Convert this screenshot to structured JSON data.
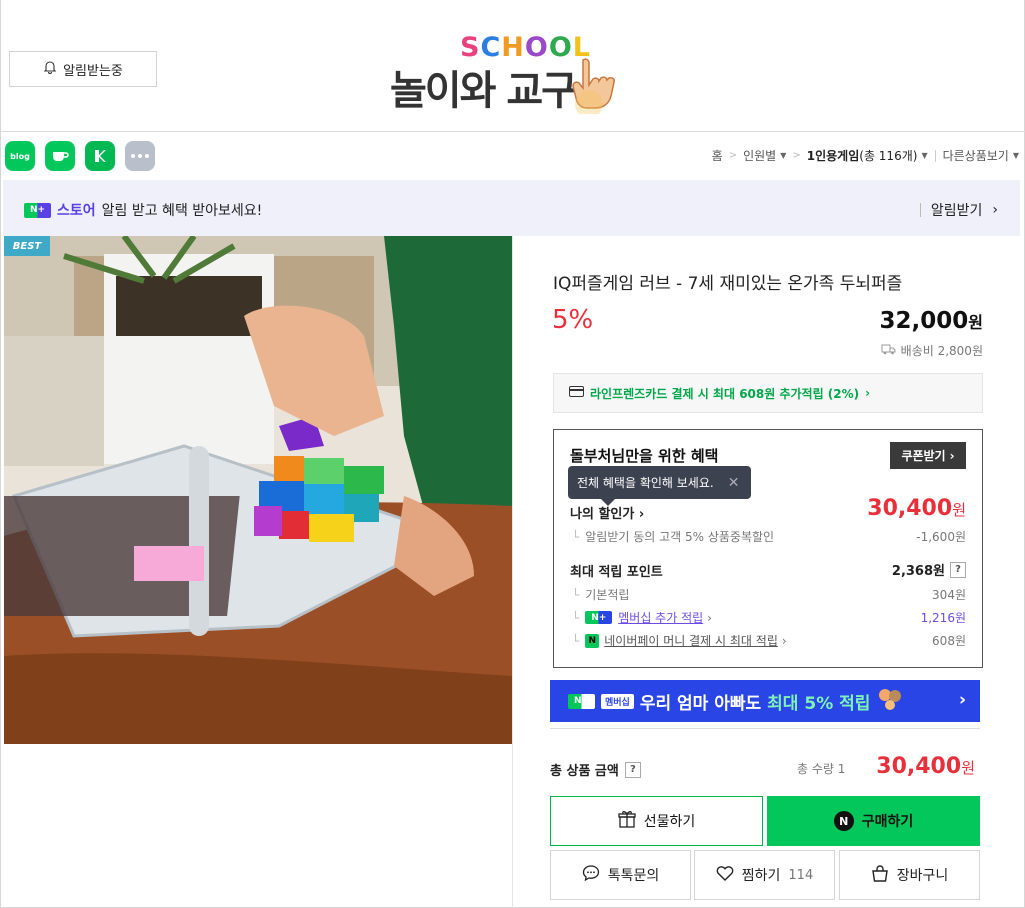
{
  "header": {
    "alarm_label": "알림받는중",
    "logo_main": "놀이와 교구",
    "logo_school": "SCHOOL"
  },
  "share": {
    "icons": [
      "blog-icon",
      "cafe-icon",
      "band-icon",
      "more-icon"
    ],
    "blog_text": "blog"
  },
  "breadcrumb": {
    "home": "홈",
    "level1": "인원별",
    "level2_prefix": "1인용게임",
    "level2_count": "(총 116개)",
    "other": "다른상품보기"
  },
  "notice": {
    "npbadge": "N+",
    "store": "스토어",
    "message": "알림 받고 혜택 받아보세요!",
    "action": "알림받기"
  },
  "product": {
    "badge": "BEST",
    "title": "IQ퍼즐게임 러브 - 7세 재미있는 온가족 두뇌퍼즐",
    "discount": "5%",
    "price": "32,000",
    "price_unit": "원",
    "shipping": "배송비 2,800원",
    "card_benefit": "라인프렌즈카드 결제 시 최대 608원 추가적립 (2%)"
  },
  "benefit": {
    "title": "돌부처님만을 위한 혜택",
    "coupon_btn": "쿠폰받기",
    "tooltip": "전체 혜택을 확인해 보세요.",
    "my_discount_label": "나의 할인가",
    "my_discount_price": "30,400",
    "my_discount_unit": "원",
    "discount_detail": "알림받기 동의 고객 5% 상품중복할인",
    "discount_detail_value": "-1,600원",
    "max_point_label": "최대 적립 포인트",
    "max_point_value": "2,368원",
    "base_label": "기본적립",
    "base_value": "304원",
    "membership_label": "멤버십 추가 적립",
    "membership_value": "1,216원",
    "npay_label": "네이버페이 머니 결제 시 최대 적립",
    "npay_value": "608원"
  },
  "banner": {
    "mem_tag": "멤버십",
    "text_a": "우리 엄마 아빠도",
    "text_b": "최대 5% 적립"
  },
  "total": {
    "label": "총 상품 금액",
    "qty": "총 수량 1",
    "price": "30,400",
    "unit": "원"
  },
  "actions": {
    "gift": "선물하기",
    "buy": "구매하기",
    "talk": "톡톡문의",
    "wish": "찜하기",
    "wish_count": "114",
    "cart": "장바구니"
  },
  "colors": {
    "accent_red": "#e8303b",
    "naver_green": "#03c75a",
    "store_purple": "#5a3fe3",
    "banner_blue": "#2a45e6"
  }
}
